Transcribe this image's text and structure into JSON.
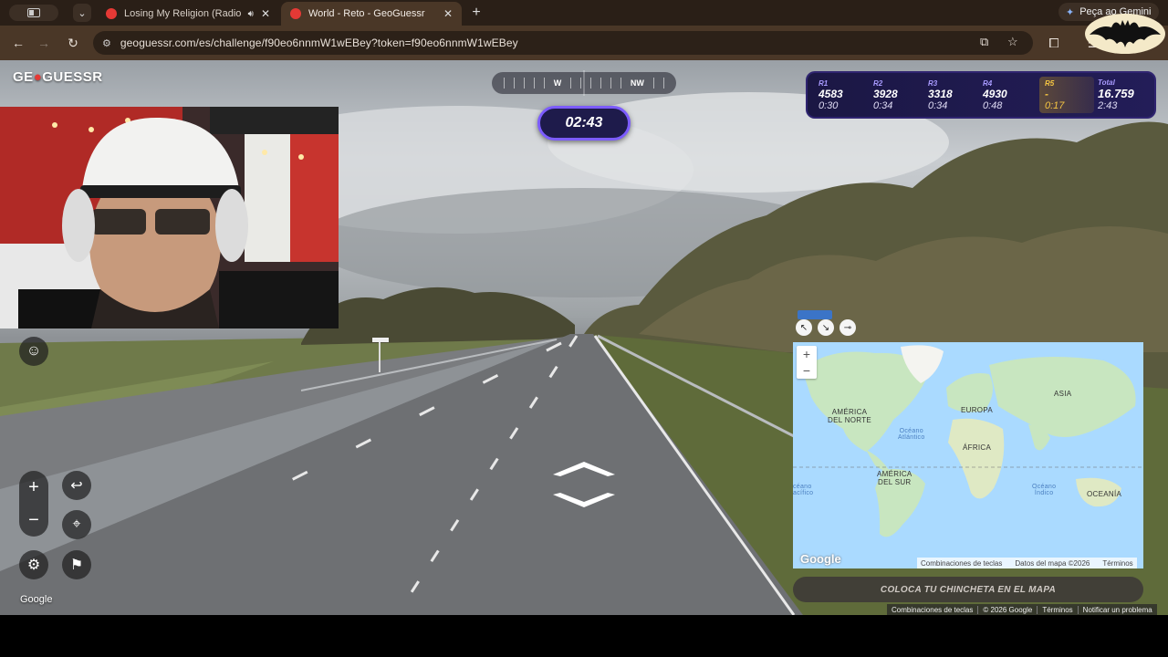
{
  "browser": {
    "tabs": [
      {
        "title": "Losing My Religion (Radio",
        "active": false,
        "favicon_color": "#e53935",
        "audio": true
      },
      {
        "title": "World - Reto - GeoGuessr",
        "active": true,
        "favicon_color": "#e53935"
      }
    ],
    "new_tab": "+",
    "gemini_label": "Peça ao Gemini",
    "url": "geoguessr.com/es/challenge/f90eo6nnmW1wEBey?token=f90eo6nnmW1wEBey"
  },
  "game": {
    "logo_pre": "GE",
    "logo_pin": "●",
    "logo_post": "GUESSR",
    "compass": {
      "left_dir": "W",
      "right_dir": "NW"
    },
    "timer": "02:43",
    "rounds": [
      {
        "label": "R1",
        "points": "4583",
        "time": "0:30"
      },
      {
        "label": "R2",
        "points": "3928",
        "time": "0:34"
      },
      {
        "label": "R3",
        "points": "3318",
        "time": "0:34"
      },
      {
        "label": "R4",
        "points": "4930",
        "time": "0:48"
      },
      {
        "label": "R5",
        "points": "-",
        "time": "0:17"
      }
    ],
    "total": {
      "label": "Total",
      "points": "16.759",
      "time": "2:43"
    },
    "street_view_google": "Google",
    "guess_button": "COLOCA TU CHINCHETA EN EL MAPA"
  },
  "map": {
    "labels": {
      "north_america": "AMÉRICA\nDEL NORTE",
      "south_america": "AMÉRICA\nDEL SUR",
      "europe": "EUROPA",
      "asia": "ASIA",
      "africa": "ÁFRICA",
      "oceania": "OCEANÍA",
      "atlantic": "Océano\nAtlántico",
      "indian": "Océano\nÍndico",
      "pacific": "céano\nacífico"
    },
    "google_logo": "Google",
    "attribution": [
      "Combinaciones de teclas",
      "Datos del mapa ©2026",
      "Términos"
    ]
  },
  "footer_links": [
    "Combinaciones de teclas",
    "© 2026 Google",
    "Términos",
    "Notificar un problema"
  ],
  "colors": {
    "timer_border": "#7c5cff",
    "panel_bg": "#1b1744",
    "current_round": "#f5c542",
    "map_water": "#aadaff",
    "map_land": "#c8e6c0"
  }
}
